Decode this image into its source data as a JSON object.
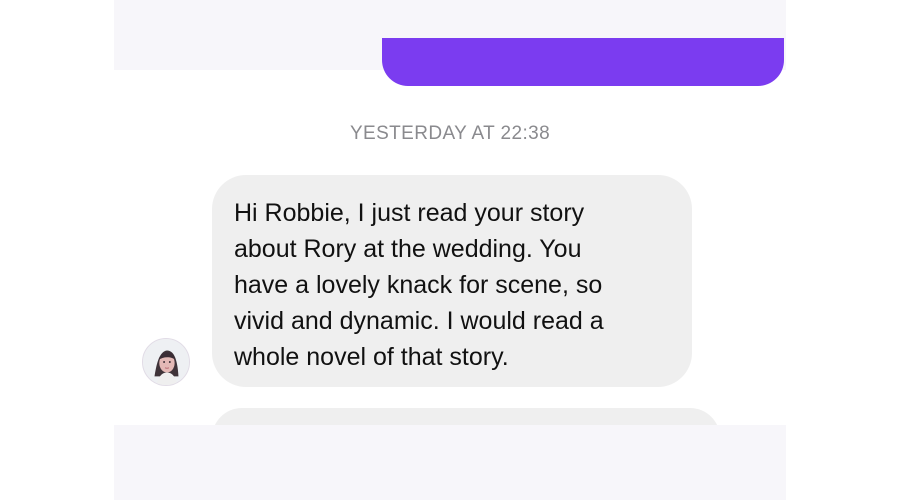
{
  "conversation": {
    "timestamp": "YESTERDAY AT 22:38",
    "received_message": {
      "text": "Hi Robbie, I just read your story\nabout Rory at the wedding. You\nhave a lovely knack for scene, so\nvivid and dynamic.  I would read a\nwhole novel of that story."
    },
    "avatar_icon": "profile-photo"
  },
  "colors": {
    "sent_bubble": "#7b3cf0",
    "received_bubble": "#efefef",
    "timestamp_text": "#8a8a8e",
    "chrome_background": "#f7f6fa"
  }
}
